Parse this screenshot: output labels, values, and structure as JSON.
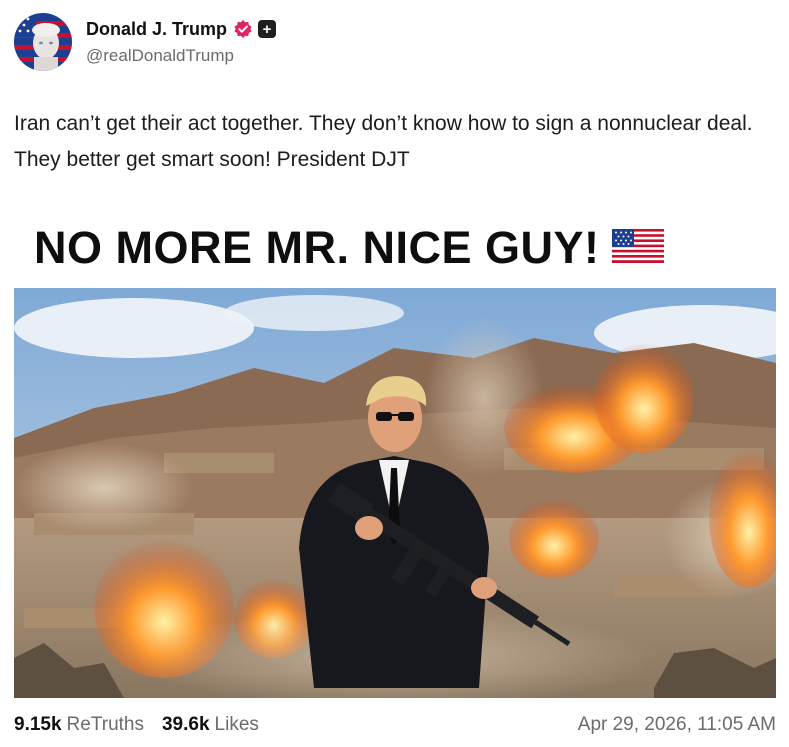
{
  "user": {
    "display_name": "Donald J. Trump",
    "handle": "@realDonaldTrump"
  },
  "post": {
    "text": "Iran can’t get their act together. They don’t know how to sign a nonnuclear deal. They better get smart soon! President DJT"
  },
  "media": {
    "headline": "NO MORE MR. NICE GUY!",
    "flag": "us-flag-icon"
  },
  "footer": {
    "retruths_count": "9.15k",
    "retruths_label": "ReTruths",
    "likes_count": "39.6k",
    "likes_label": "Likes",
    "timestamp": "Apr 29, 2026, 11:05 AM"
  },
  "colors": {
    "verified": "#e0245e",
    "muted": "#6b6b6b",
    "text": "#1c1c1c"
  }
}
